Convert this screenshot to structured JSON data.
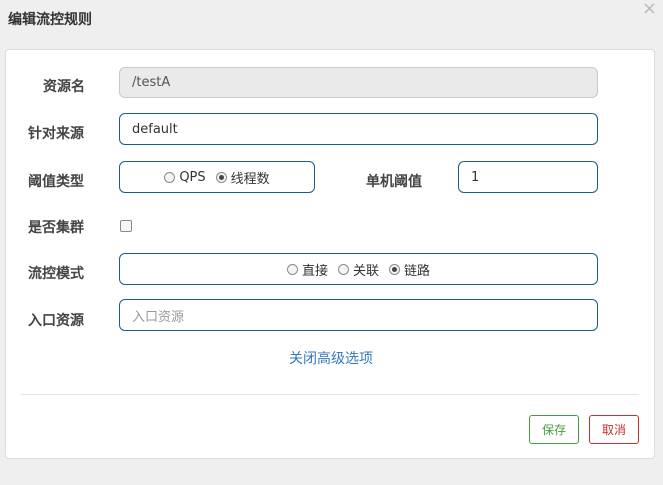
{
  "dialog": {
    "title": "编辑流控规则",
    "close_glyph": "×"
  },
  "form": {
    "resource": {
      "label": "资源名",
      "value": "/testA"
    },
    "limit_app": {
      "label": "针对来源",
      "value": "default"
    },
    "threshold_type": {
      "label": "阈值类型",
      "options": [
        "QPS",
        "线程数"
      ],
      "selected": "线程数"
    },
    "single_threshold": {
      "label": "单机阈值",
      "value": "1"
    },
    "cluster_mode": {
      "label": "是否集群",
      "checked": false
    },
    "control_mode": {
      "label": "流控模式",
      "options": [
        "直接",
        "关联",
        "链路"
      ],
      "selected": "链路"
    },
    "entry_resource": {
      "label": "入口资源",
      "placeholder": "入口资源",
      "value": ""
    },
    "advanced_toggle": "关闭高级选项"
  },
  "buttons": {
    "save": "保存",
    "cancel": "取消"
  },
  "colors": {
    "field_border": "#1a5e84",
    "link": "#337ab7",
    "save": "#449d44",
    "cancel": "#c9302c"
  }
}
